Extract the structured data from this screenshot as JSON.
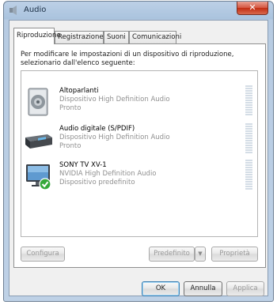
{
  "window": {
    "title": "Audio",
    "close_glyph": "✕"
  },
  "tabs": [
    {
      "label": "Riproduzione",
      "active": true
    },
    {
      "label": "Registrazione",
      "active": false
    },
    {
      "label": "Suoni",
      "active": false
    },
    {
      "label": "Comunicazioni",
      "active": false
    }
  ],
  "instruction": "Per modificare le impostazioni di un dispositivo di riproduzione, selezionario dall'elenco seguente:",
  "devices": [
    {
      "name": "Altoparlanti",
      "description": "Dispositivo High Definition Audio",
      "status": "Pronto",
      "icon": "speaker-icon"
    },
    {
      "name": "Audio digitale (S/PDIF)",
      "description": "Dispositivo High Definition Audio",
      "status": "Pronto",
      "icon": "digital-audio-receiver-icon"
    },
    {
      "name": "SONY TV XV-1",
      "description": "NVIDIA High Definition Audio",
      "status": "Dispositivo predefinito",
      "icon": "monitor-default-icon"
    }
  ],
  "buttons": {
    "configure": "Configura",
    "set_default": "Predefinito",
    "properties": "Proprietà",
    "ok": "OK",
    "cancel": "Annulla",
    "apply": "Applica"
  }
}
